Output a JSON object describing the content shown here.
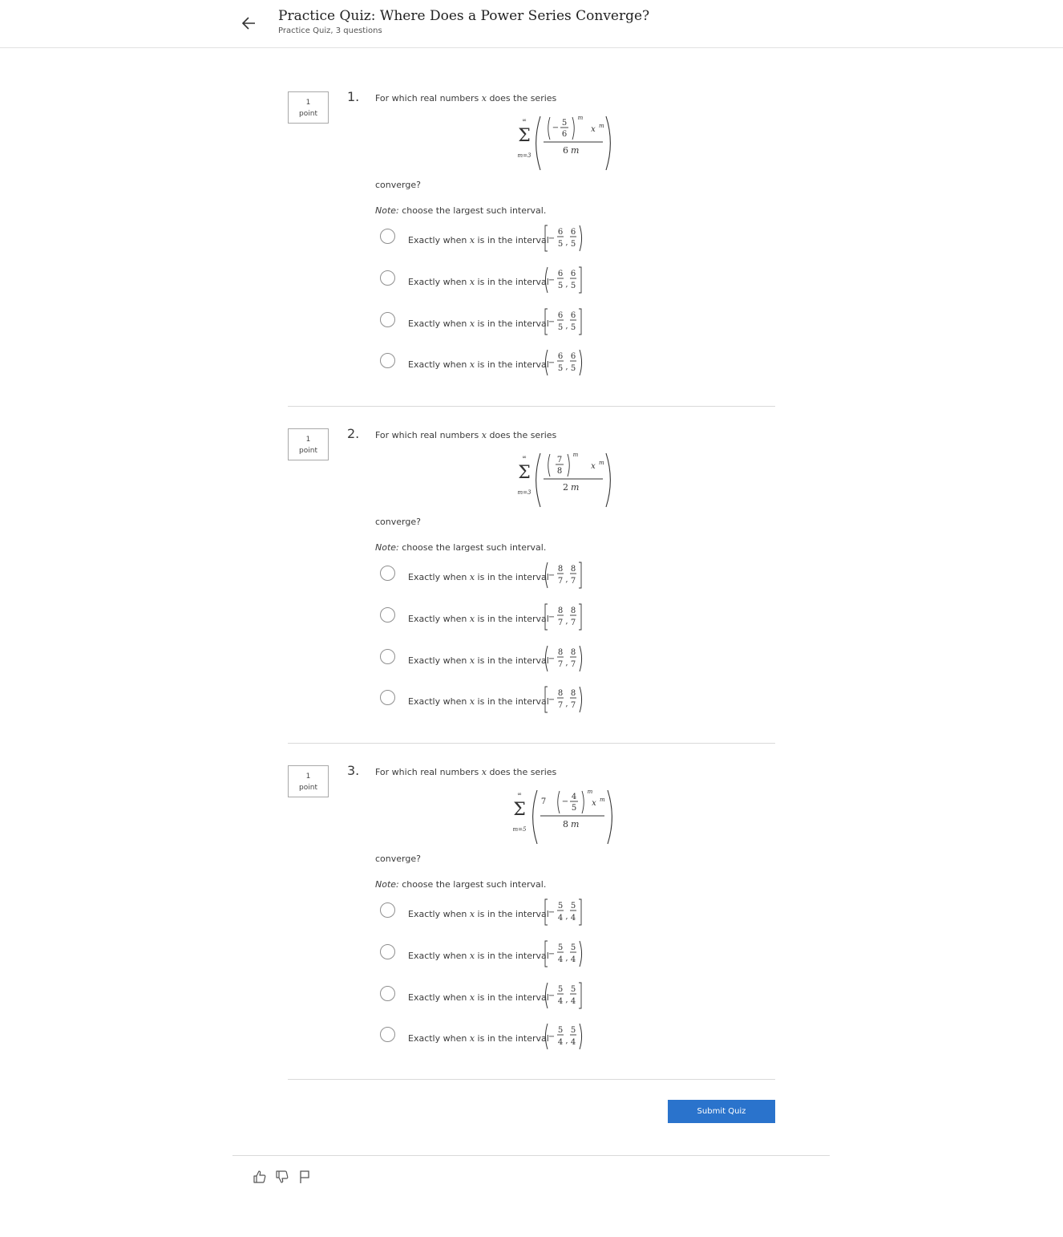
{
  "header": {
    "title": "Practice Quiz: Where Does a Power Series Converge?",
    "subtitle": "Practice Quiz, 3 questions",
    "back_icon": "arrow-left-icon"
  },
  "points": {
    "value": "1",
    "unit": "point"
  },
  "common": {
    "prompt_before": "For which real numbers ",
    "prompt_var": "x",
    "prompt_after": " does the series",
    "converge": "converge?",
    "note_label": "Note:",
    "note_text": " choose the largest such interval.",
    "option_before": "Exactly when ",
    "option_var": "x",
    "option_after": " is in the interval"
  },
  "questions": [
    {
      "number": "1.",
      "series": {
        "lower": "m=3",
        "upper": "∞",
        "coef": "",
        "base_sign": "−",
        "base_num": "5",
        "base_den": "6",
        "exp": "m",
        "x_term": "x",
        "x_exp": "m",
        "den_coef": "6",
        "den_var": "m"
      },
      "options": [
        {
          "left": "[",
          "right": ")",
          "lo_sign": "−",
          "num": "6",
          "den": "5"
        },
        {
          "left": "(",
          "right": "]",
          "lo_sign": "−",
          "num": "6",
          "den": "5"
        },
        {
          "left": "[",
          "right": "]",
          "lo_sign": "−",
          "num": "6",
          "den": "5"
        },
        {
          "left": "(",
          "right": ")",
          "lo_sign": "−",
          "num": "6",
          "den": "5"
        }
      ]
    },
    {
      "number": "2.",
      "series": {
        "lower": "m=3",
        "upper": "∞",
        "coef": "",
        "base_sign": "",
        "base_num": "7",
        "base_den": "8",
        "exp": "m",
        "x_term": "x",
        "x_exp": "m",
        "den_coef": "2",
        "den_var": "m"
      },
      "options": [
        {
          "left": "(",
          "right": "]",
          "lo_sign": "−",
          "num": "8",
          "den": "7"
        },
        {
          "left": "[",
          "right": "]",
          "lo_sign": "−",
          "num": "8",
          "den": "7"
        },
        {
          "left": "(",
          "right": ")",
          "lo_sign": "−",
          "num": "8",
          "den": "7"
        },
        {
          "left": "[",
          "right": ")",
          "lo_sign": "−",
          "num": "8",
          "den": "7"
        }
      ]
    },
    {
      "number": "3.",
      "series": {
        "lower": "m=5",
        "upper": "∞",
        "coef": "7",
        "base_sign": "−",
        "base_num": "4",
        "base_den": "5",
        "exp": "m",
        "x_term": "x",
        "x_exp": "m",
        "den_coef": "8",
        "den_var": "m"
      },
      "options": [
        {
          "left": "[",
          "right": "]",
          "lo_sign": "−",
          "num": "5",
          "den": "4"
        },
        {
          "left": "[",
          "right": ")",
          "lo_sign": "−",
          "num": "5",
          "den": "4"
        },
        {
          "left": "(",
          "right": "]",
          "lo_sign": "−",
          "num": "5",
          "den": "4"
        },
        {
          "left": "(",
          "right": ")",
          "lo_sign": "−",
          "num": "5",
          "den": "4"
        }
      ]
    }
  ],
  "submit": {
    "label": "Submit Quiz"
  },
  "footer": {
    "icons": [
      "thumbs-up-icon",
      "thumbs-down-icon",
      "flag-icon"
    ]
  },
  "colors": {
    "accent": "#2a73cc",
    "border": "#a8a8a8",
    "divider": "#d9d9d9"
  }
}
